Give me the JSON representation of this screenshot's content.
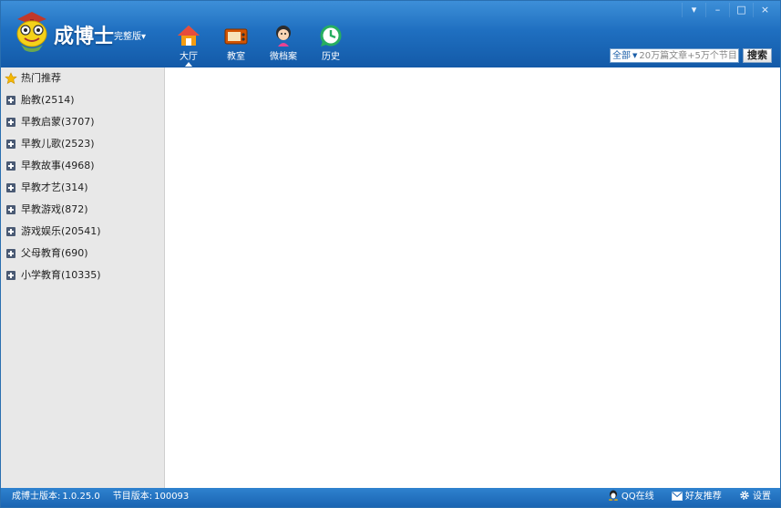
{
  "app": {
    "brand": "成博士",
    "edition": "完整版▾"
  },
  "nav": [
    {
      "label": "大厅",
      "icon": "house-icon"
    },
    {
      "label": "教室",
      "icon": "tv-icon"
    },
    {
      "label": "微档案",
      "icon": "child-avatar-icon"
    },
    {
      "label": "历史",
      "icon": "history-clock-icon"
    }
  ],
  "window_controls": {
    "dropdown": "▾",
    "minimize": "–",
    "maximize": "□",
    "close": "×"
  },
  "search": {
    "scope": "全部",
    "placeholder": "20万篇文章+5万个节目",
    "button": "搜索"
  },
  "sidebar": {
    "featured": "热门推荐",
    "items": [
      {
        "label": "胎教(2514)"
      },
      {
        "label": "早教启蒙(3707)"
      },
      {
        "label": "早教儿歌(2523)"
      },
      {
        "label": "早教故事(4968)"
      },
      {
        "label": "早教才艺(314)"
      },
      {
        "label": "早教游戏(872)"
      },
      {
        "label": "游戏娱乐(20541)"
      },
      {
        "label": "父母教育(690)"
      },
      {
        "label": "小学教育(10335)"
      }
    ]
  },
  "status": {
    "app_version_label": "成博士版本:",
    "app_version": "1.0.25.0",
    "program_version_label": "节目版本:",
    "program_version": "100093",
    "qq": "QQ在线",
    "recommend": "好友推荐",
    "settings": "设置"
  },
  "colors": {
    "header_top": "#3d8fd8",
    "header_bottom": "#135aa8",
    "sidebar_bg": "#e8e8e8",
    "accent": "#1a5ea8"
  }
}
